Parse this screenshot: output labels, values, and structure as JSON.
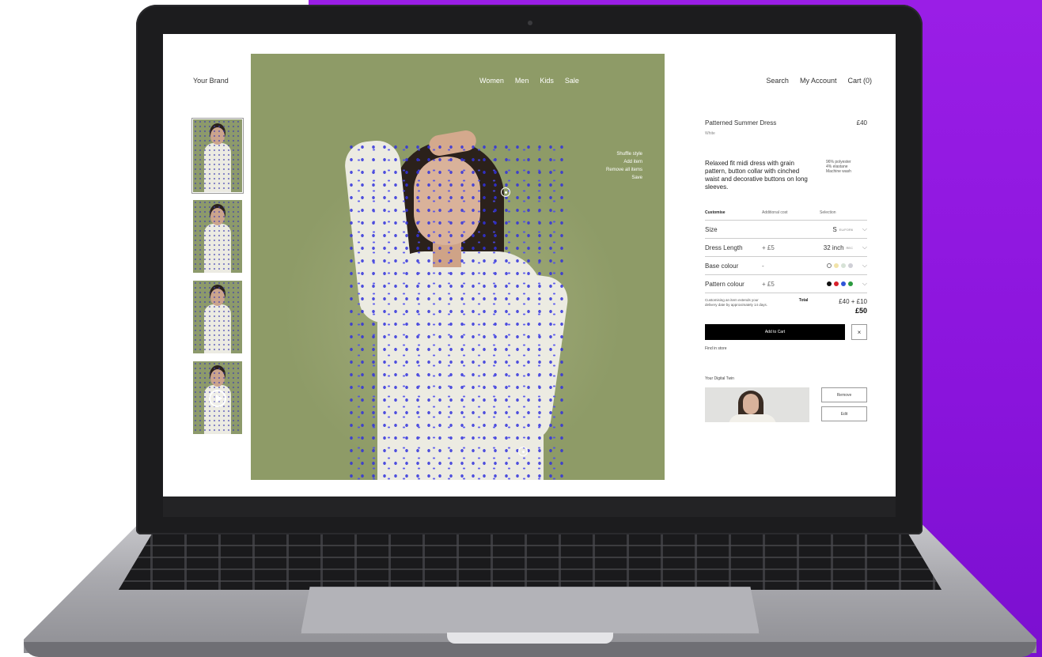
{
  "header": {
    "brand": "Your Brand",
    "nav": [
      "Women",
      "Men",
      "Kids",
      "Sale"
    ],
    "utility": [
      "Search",
      "My Account",
      "Cart (0)"
    ]
  },
  "hero_menu": [
    "Shuffle style",
    "Add item",
    "Remove all items",
    "Save"
  ],
  "product": {
    "name": "Patterned Summer Dress",
    "price": "£40",
    "color": "White",
    "description": "Relaxed fit midi dress with grain pattern, button collar with cinched waist and decorative buttons on long sleeves.",
    "materials": [
      "96% polyester",
      "4% elastane",
      "Machine wash"
    ]
  },
  "customise": {
    "headers": [
      "Customise",
      "Additional cost",
      "Selection"
    ],
    "options": [
      {
        "label": "Size",
        "cost": "",
        "selection": "S",
        "selection_sup": "EU/FOR6"
      },
      {
        "label": "Dress Length",
        "cost": "+ £5",
        "selection": "32 inch",
        "selection_sup": "REC"
      },
      {
        "label": "Base colour",
        "cost": "-",
        "swatches": [
          "#ffffff",
          "#f1e3a8",
          "#d6e2d6",
          "#cfcfd6"
        ]
      },
      {
        "label": "Pattern colour",
        "cost": "+ £5",
        "swatches": [
          "#111111",
          "#d8202a",
          "#2f54d8",
          "#2a9a3e"
        ]
      }
    ],
    "note": "Customising an item extends your delivery date by approximately 14 days.",
    "total_label": "Total",
    "total_breakdown": "£40 + £10",
    "total": "£50"
  },
  "actions": {
    "add_to_cart": "Add to Cart",
    "close": "×",
    "find_in_store": "Find in store"
  },
  "digital_twin": {
    "label": "Your Digital Twin",
    "remove": "Remove",
    "edit": "Edit"
  },
  "colors": {
    "background_purple": "#8a14dc",
    "hero_green": "#8e9b67",
    "pattern_blue": "#3232dd"
  }
}
